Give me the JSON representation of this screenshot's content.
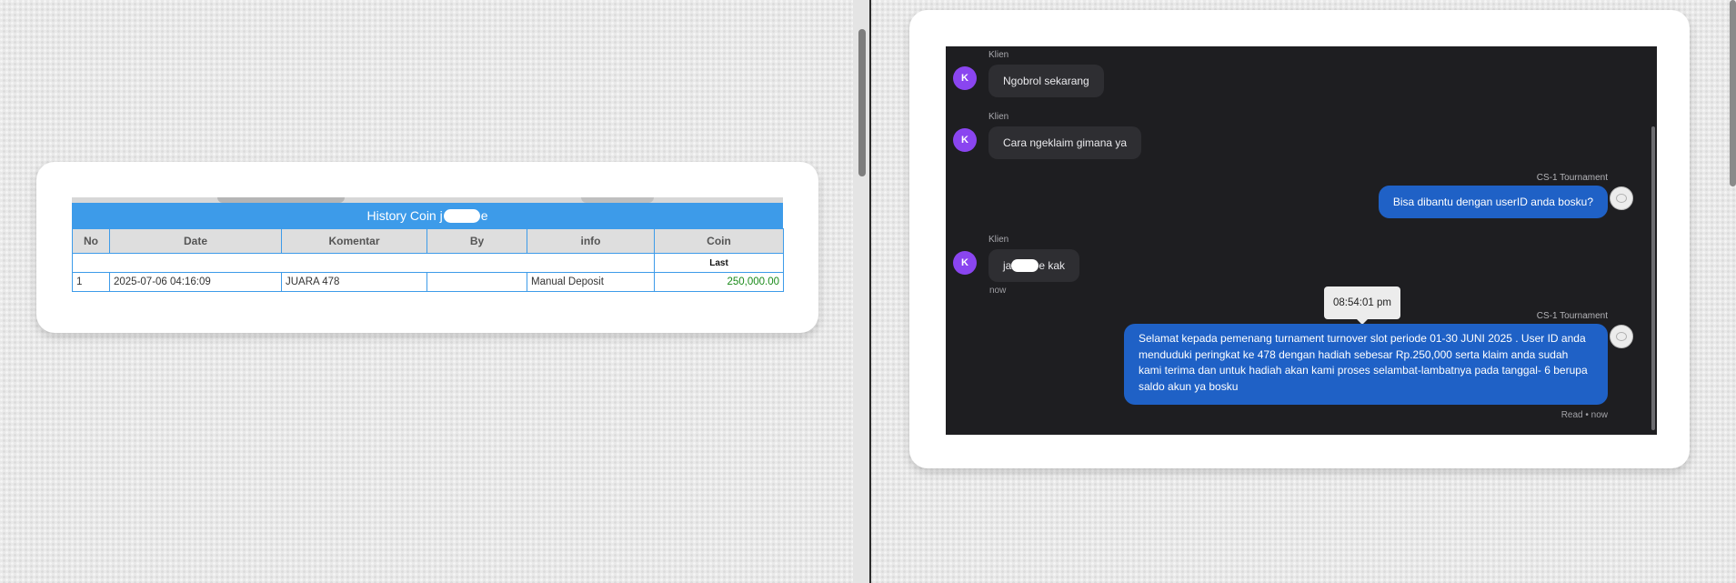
{
  "history": {
    "title_prefix": "History Coin j",
    "title_suffix": "e",
    "columns": [
      "No",
      "Date",
      "Komentar",
      "By",
      "info",
      "Coin"
    ],
    "subheader_label": "Last",
    "rows": [
      {
        "no": "1",
        "date": "2025-07-06 04:16:09",
        "komentar": "JUARA 478",
        "by": "",
        "info": "Manual Deposit",
        "coin": "250,000.00"
      }
    ]
  },
  "chat": {
    "client_label": "Klien",
    "client_avatar": "K",
    "agent_label": "CS-1 Tournament",
    "messages": [
      {
        "text": "Ngobrol sekarang"
      },
      {
        "text": "Cara ngeklaim gimana ya"
      },
      {
        "text": "Bisa dibantu dengan userID anda bosku?"
      },
      {
        "text_prefix": "ja",
        "text_suffix": "e kak",
        "time": "now"
      },
      {
        "text": "Selamat kepada pemenang turnament turnover slot periode 01-30 JUNI 2025 . User ID anda menduduki peringkat ke 478 dengan hadiah sebesar Rp.250,000 serta klaim anda sudah kami terima dan untuk hadiah akan kami proses selambat-lambatnya pada tanggal- 6 berupa saldo akun ya bosku"
      }
    ],
    "tooltip": "08:54:01 pm",
    "read_status": "Read • now"
  },
  "colors": {
    "table_accent": "#3d9be9",
    "client_avatar": "#8a45f0",
    "agent_bubble": "#1f61c6",
    "chat_bg": "#1e1e21",
    "coin_value": "#1a8a1a"
  },
  "icons": {
    "agent_avatar": "agent-avatar-icon",
    "splitter": "vertical-scrollbar"
  }
}
